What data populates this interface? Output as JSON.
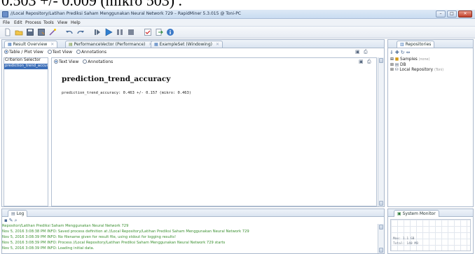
{
  "cropped_text": "0.503 +/- 0.009 (mikro 503) .",
  "window": {
    "title": "//Local Repository/Latihan Prediksi Saham Menggunakan Neural Network 729 – RapidMiner 5.3.015 @ Toni-PC",
    "min_label": "–",
    "max_label": "□",
    "close_label": "✕"
  },
  "menu": [
    "File",
    "Edit",
    "Process",
    "Tools",
    "View",
    "Help"
  ],
  "toolbar_icons": [
    "new-icon",
    "open-icon",
    "save-icon",
    "save-as-icon",
    "wizard-icon",
    "undo-icon",
    "redo-icon",
    "step-icon",
    "run-icon",
    "pause-icon",
    "stop-icon",
    "validate-icon",
    "export-icon",
    "info-icon"
  ],
  "result_tabs": [
    {
      "label": "Result Overview",
      "icon": "overview-icon"
    },
    {
      "label": "PerformanceVector (Performance)",
      "icon": "performance-icon"
    },
    {
      "label": "ExampleSet (Windowing)",
      "icon": "table-icon"
    }
  ],
  "views": {
    "outer": [
      "Table / Plot View",
      "Text View",
      "Annotations"
    ],
    "inner": [
      "Text View",
      "Annotations"
    ]
  },
  "criterion": {
    "header": "Criterion Selector",
    "items": [
      "prediction_trend_accurac"
    ]
  },
  "result": {
    "title": "prediction_trend_accuracy",
    "text": "prediction_trend_accuracy: 0.463 +/- 0.157 (mikro: 0.463)"
  },
  "repositories": {
    "title": "Repositories",
    "items": [
      {
        "label": "Samples",
        "suffix": "(none)",
        "icon": "samples-icon"
      },
      {
        "label": "DB",
        "suffix": "",
        "icon": "db-icon"
      },
      {
        "label": "Local Repository",
        "suffix": "(Toni)",
        "icon": "local-repo-icon"
      }
    ]
  },
  "log": {
    "title": "Log",
    "lines": [
      "Repositori/Latihan Prediksi Saham Menggunakan Neural Network 729",
      "Nov 5, 2016 3:08:38 PM INFO: Saved process definition at //Local Repository/Latihan Prediksi Saham Menggunakan Neural Network 729",
      "Nov 5, 2016 3:08:39 PM INFO: No filename given for result file, using stdout for logging results!",
      "Nov 5, 2016 3:08:39 PM INFO: Process //Local Repository/Latihan Prediksi Saham Menggunakan Neural Network 729 starts",
      "Nov 5, 2016 3:08:39 PM INFO: Loading initial data."
    ]
  },
  "monitor": {
    "title": "System Monitor",
    "max_label": "Max:   1.1 GB",
    "total_label": "Total: 140 MB"
  },
  "colors": {
    "accent": "#1d5db5",
    "log_text": "#3a8f2f",
    "selection": "#3d6fb8"
  }
}
